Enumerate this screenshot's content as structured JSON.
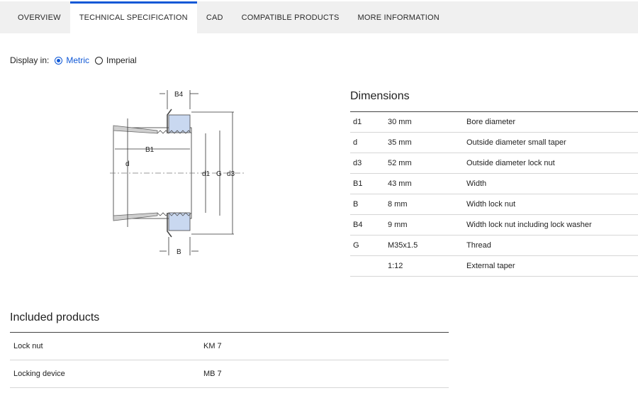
{
  "tabs": [
    {
      "label": "OVERVIEW",
      "active": false
    },
    {
      "label": "TECHNICAL SPECIFICATION",
      "active": true
    },
    {
      "label": "CAD",
      "active": false
    },
    {
      "label": "COMPATIBLE PRODUCTS",
      "active": false
    },
    {
      "label": "MORE INFORMATION",
      "active": false
    }
  ],
  "display": {
    "label": "Display in:",
    "options": [
      {
        "label": "Metric",
        "selected": true
      },
      {
        "label": "Imperial",
        "selected": false
      }
    ]
  },
  "drawing": {
    "labels": {
      "b4": "B4",
      "b1": "B1",
      "d": "d",
      "d1": "d1",
      "g": "G",
      "d3": "d3",
      "b": "B"
    }
  },
  "dimensions": {
    "title": "Dimensions",
    "rows": [
      {
        "symbol": "d1",
        "value": "30 mm",
        "description": "Bore diameter"
      },
      {
        "symbol": "d",
        "value": "35 mm",
        "description": "Outside diameter small taper"
      },
      {
        "symbol": "d3",
        "value": "52 mm",
        "description": "Outside diameter lock nut"
      },
      {
        "symbol": "B1",
        "value": "43 mm",
        "description": "Width"
      },
      {
        "symbol": "B",
        "value": "8 mm",
        "description": "Width lock nut"
      },
      {
        "symbol": "B4",
        "value": "9 mm",
        "description": "Width lock nut including lock washer"
      },
      {
        "symbol": "G",
        "value": "M35x1.5",
        "description": "Thread"
      },
      {
        "symbol": "",
        "value": "1:12",
        "description": "External taper"
      }
    ]
  },
  "included": {
    "title": "Included products",
    "rows": [
      {
        "name": "Lock nut",
        "value": "KM 7"
      },
      {
        "name": "Locking device",
        "value": "MB 7"
      }
    ]
  },
  "colors": {
    "accent": "#0f58d6",
    "nut_fill": "#c9d8f0"
  }
}
